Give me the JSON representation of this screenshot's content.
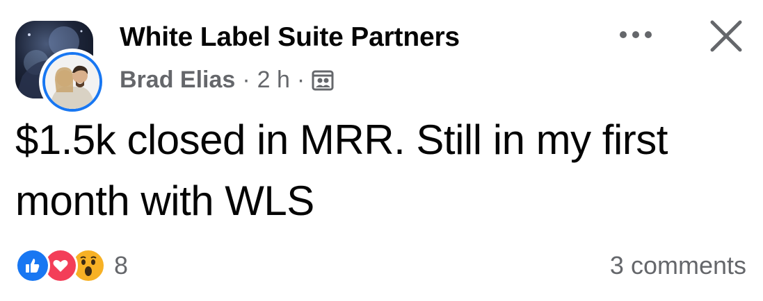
{
  "post": {
    "group_name": "White Label Suite Partners",
    "author": "Brad Elias",
    "separator": "·",
    "time": "2 h",
    "audience_icon": "group-audience-icon",
    "text": "$1.5k closed in MRR. Still in my first month with WLS",
    "reactions": {
      "types": [
        "like-icon",
        "love-icon",
        "wow-icon"
      ],
      "count": "8"
    },
    "comments": "3 comments"
  },
  "header": {
    "more_icon": "more-options-icon",
    "close_icon": "close-icon"
  },
  "colors": {
    "primary_text": "#050505",
    "secondary_text": "#65676b",
    "accent": "#1877f2",
    "love": "#f33e58",
    "wow": "#f7b125"
  }
}
